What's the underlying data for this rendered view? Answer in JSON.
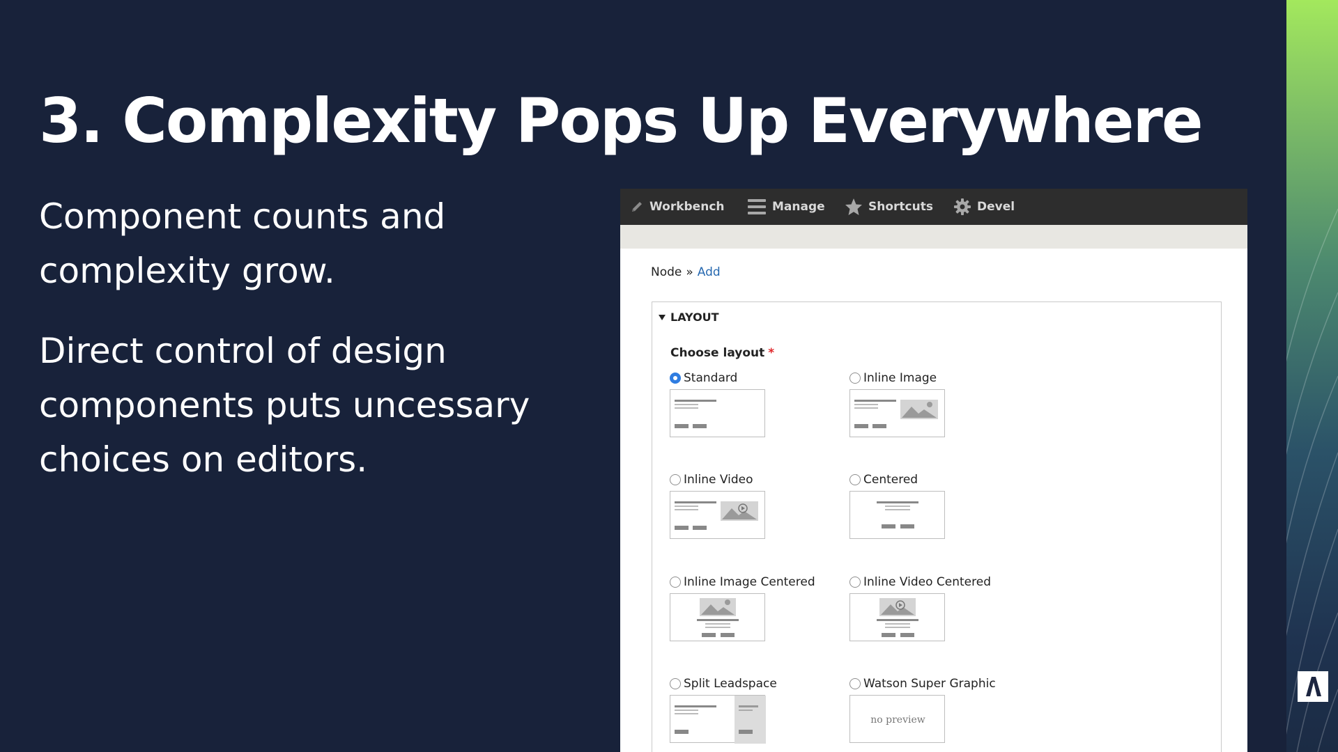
{
  "slide": {
    "title": "3. Complexity Pops Up Everywhere",
    "paragraphs": [
      "Component counts and complexity grow.",
      "Direct control of design components puts uncessary choices on editors."
    ]
  },
  "toolbar": {
    "items": [
      {
        "label": "Workbench",
        "icon": "pencil-icon"
      },
      {
        "label": "Manage",
        "icon": "menu-icon"
      },
      {
        "label": "Shortcuts",
        "icon": "star-icon"
      },
      {
        "label": "Devel",
        "icon": "gear-icon"
      }
    ]
  },
  "breadcrumb": {
    "items": [
      "Node",
      "»",
      "Add"
    ]
  },
  "layout_section": {
    "legend": "LAYOUT",
    "choose_label": "Choose layout",
    "required_mark": "*",
    "selected": "Standard",
    "options": [
      {
        "label": "Standard",
        "checked": true
      },
      {
        "label": "Inline Image",
        "checked": false
      },
      {
        "label": "Inline Video",
        "checked": false
      },
      {
        "label": "Centered",
        "checked": false
      },
      {
        "label": "Inline Image Centered",
        "checked": false
      },
      {
        "label": "Inline Video Centered",
        "checked": false
      },
      {
        "label": "Split Leadspace",
        "checked": false
      },
      {
        "label": "Watson Super Graphic",
        "checked": false,
        "preview_text": "no preview"
      }
    ]
  },
  "colors": {
    "background": "#18223a",
    "toolbar": "#2d2d2d",
    "link": "#2769b0",
    "radio_selected": "#2f7de1",
    "required": "#e0282b",
    "accent_green": "#a3e85d"
  }
}
